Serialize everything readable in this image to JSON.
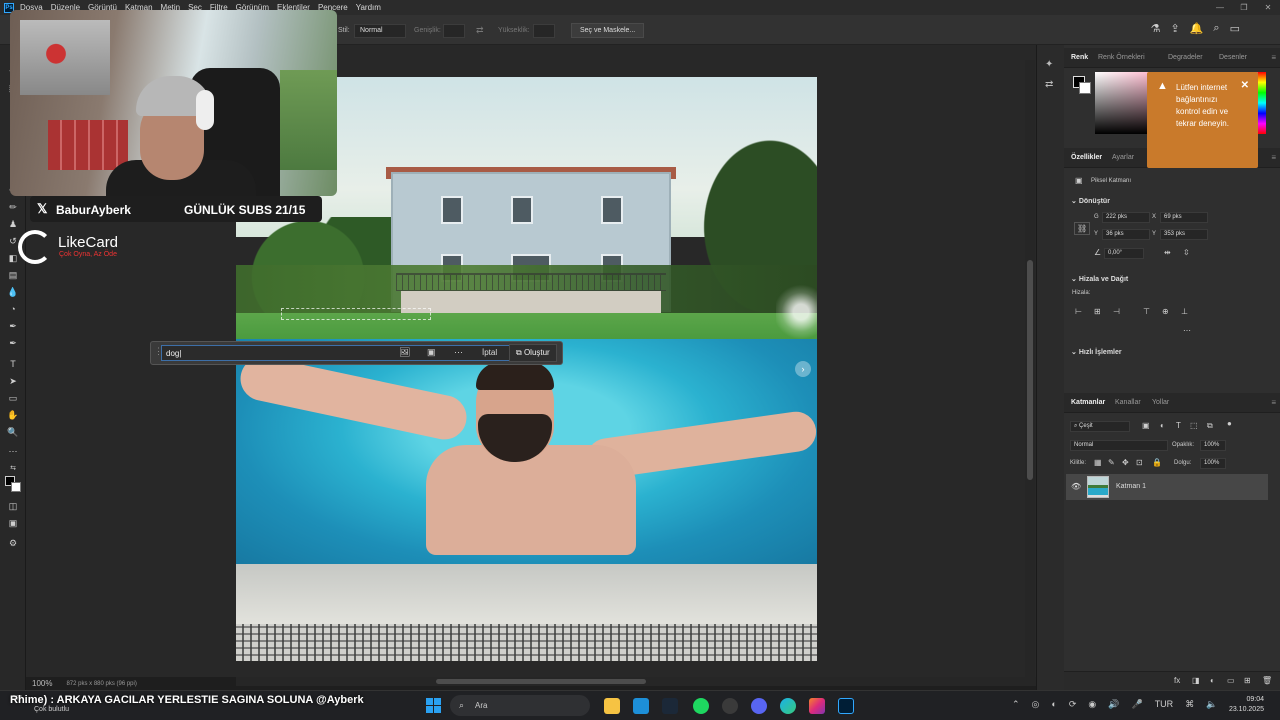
{
  "menubar": {
    "items": [
      "Dosya",
      "Düzenle",
      "Görüntü",
      "Katman",
      "Metin",
      "Seç",
      "Filtre",
      "Görünüm",
      "Eklentiler",
      "Pencere",
      "Yardım"
    ]
  },
  "options_bar": {
    "style_label": "Stil:",
    "style_value": "Normal",
    "width_label": "Genişlik:",
    "height_label": "Yükseklik:",
    "select_mask_button": "Seç ve Maskele..."
  },
  "generative_bar": {
    "prompt_value": "dog|",
    "cancel_label": "İptal",
    "create_label": "Oluştur"
  },
  "status": {
    "zoom": "100%",
    "doc_size": "872 pks x 880 pks (96 ppi)"
  },
  "panels": {
    "color_tabs": [
      "Renk",
      "Renk Örnekleri",
      "Degradeler",
      "Desenler"
    ],
    "toast_message": "Lütfen internet bağlantınızı kontrol edin ve tekrar deneyin.",
    "props_tabs": [
      "Özellikler",
      "Ayarlar"
    ],
    "pixel_layer_label": "Piksel Katmanı",
    "transform_title": "Dönüştür",
    "w_label": "G",
    "w_value": "222 pks",
    "x_label": "X",
    "x_value": "69 pks",
    "h_label": "Y",
    "h_value": "36 pks",
    "y_label": "Y",
    "y_value": "353 pks",
    "angle_value": "0,00°",
    "align_title": "Hizala ve Dağıt",
    "align_label": "Hizala:",
    "quick_title": "Hızlı İşlemler",
    "layer_tabs": [
      "Katmanlar",
      "Kanallar",
      "Yollar"
    ],
    "layer_filter": "Çeşit",
    "blend_mode": "Normal",
    "opacity_label": "Opaklık:",
    "opacity_value": "100%",
    "lock_label": "Kilitle:",
    "fill_label": "Dolgu:",
    "fill_value": "100%",
    "layer_name": "Katman 1"
  },
  "overlay": {
    "x_handle": "BaburAyberk",
    "subs_counter": "GÜNLÜK SUBS 21/15",
    "sponsor_name": "LikeCard",
    "sponsor_slogan": "Çok Oyna, Az Öde",
    "ticker_text": "Rhime) : ARKAYA GACILAR YERLESTIE SAGINA SOLUNA @Ayberk",
    "ticker_sub": "Çok bulutlu",
    "ticker_badge": "17°"
  },
  "taskbar": {
    "search_placeholder": "Ara",
    "lang": "TUR",
    "time": "09:04",
    "date": "23.10.2025"
  }
}
